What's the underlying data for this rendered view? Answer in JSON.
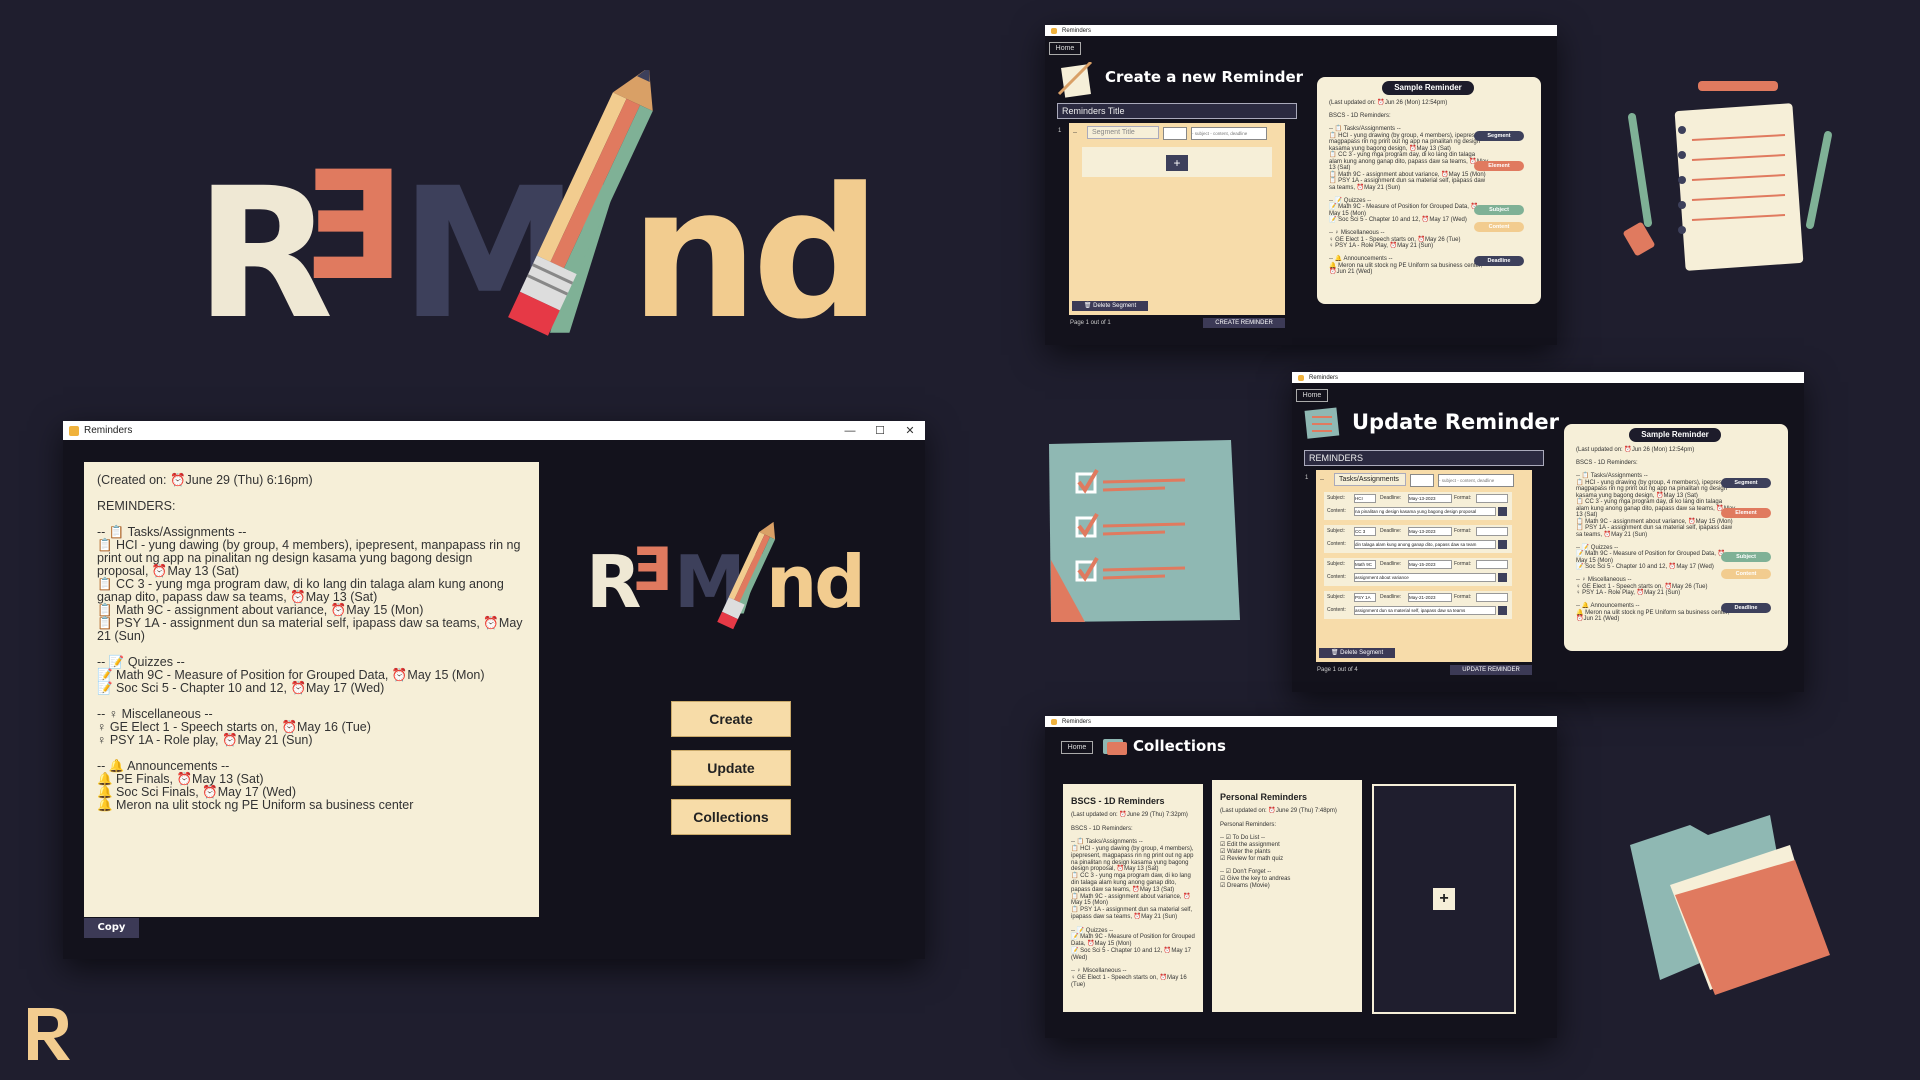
{
  "brand": {
    "logo_letters": [
      "R",
      "Ǝ",
      "M",
      "/",
      "nd"
    ],
    "colors": {
      "bg": "#1f1e2e",
      "cream": "#f6efd8",
      "orange": "#e07a5f",
      "navy": "#3d405b",
      "green": "#7fb196",
      "sand": "#f2cc8f"
    }
  },
  "main_window": {
    "title": "Reminders",
    "controls": {
      "minimize": "—",
      "maximize": "☐",
      "close": "✕"
    },
    "content": "(Created on: ⏰June 29 (Thu) 6:16pm)\n\nREMINDERS:\n\n-- 📋 Tasks/Assignments --\n📋 HCI - yung dawing (by group, 4 members), ipepresent, manpapass rin ng print out ng app na pinalitan ng design kasama yung bagong design proposal, ⏰May 13 (Sat)\n📋 CC 3 - yung mga program daw, di ko lang din talaga alam kung anong ganap dito, papass daw sa teams, ⏰May 13 (Sat)\n📋 Math 9C - assignment about variance, ⏰May 15 (Mon)\n📋 PSY 1A - assignment dun sa material self, ipapass daw sa teams, ⏰May 21 (Sun)\n\n-- 📝 Quizzes --\n📝 Math 9C - Measure of Position for Grouped Data, ⏰May 15 (Mon)\n📝 Soc Sci 5 - Chapter 10 and 12, ⏰May 17 (Wed)\n\n-- ♀ Miscellaneous --\n♀ GE Elect 1 - Speech starts on, ⏰May 16 (Tue)\n♀ PSY 1A - Role play, ⏰May 21 (Sun)\n\n-- 🔔 Announcements --\n🔔 PE Finals, ⏰May 13 (Sat)\n🔔 Soc Sci Finals, ⏰May 17 (Wed)\n🔔 Meron na ulit stock ng PE Uniform sa business center",
    "copy_label": "Copy",
    "buttons": {
      "create": "Create",
      "update": "Update",
      "collections": "Collections"
    }
  },
  "create_window": {
    "title": "Reminders",
    "home_label": "Home",
    "heading": "Create a new Reminder",
    "title_field": "Reminders Title",
    "row_number": "1",
    "dash": "--",
    "segment_placeholder": "Segment Title",
    "format_placeholder": "- subject - content, deadline",
    "plus": "+",
    "delete_label": "🗑 Delete Segment",
    "page_label": "Page 1 out of 1",
    "create_label": "CREATE REMINDER"
  },
  "update_window": {
    "title": "Reminders",
    "home_label": "Home",
    "heading": "Update Reminder",
    "title_field": "REMINDERS",
    "row_number": "1",
    "dash": "--",
    "segment_value": "Tasks/Assignments",
    "format_placeholder": "- subject - content, deadline",
    "rows": [
      {
        "subject": "HCI",
        "deadline": "May-13-2023",
        "content": "na pinalitan ng design kasama yung bagong design proposal"
      },
      {
        "subject": "CC 3",
        "deadline": "May-13-2023",
        "content": "din talaga alam kung anong ganap dito, papass daw sa team"
      },
      {
        "subject": "Math 9C",
        "deadline": "May-15-2023",
        "content": "assignment about variance"
      },
      {
        "subject": "PSY 1A",
        "deadline": "May-21-2023",
        "content": "assignment dun sa material self, ipapass daw sa teams"
      }
    ],
    "labels": {
      "subject": "Subject:",
      "deadline": "Deadline:",
      "format": "Format:",
      "content": "Content:"
    },
    "delete_label": "🗑 Delete Segment",
    "page_label": "Page 1 out of 4",
    "update_label": "UPDATE REMINDER"
  },
  "sample_panel": {
    "header": "Sample Reminder",
    "text": "(Last updated on: ⏰Jun 26 (Mon) 12:54pm)\n\nBSCS - 1D Reminders:\n\n-- 📋 Tasks/Assignments --\n📋 HCI - yung drawing (by group, 4 members), ipepresent, magpapass rin ng print out ng app na pinalitan ng design kasama yung bagong design, ⏰May 13 (Sat)\n📋 CC 3 - yung mga program day, di ko lang din talaga alam kung anong ganap dito, papass daw sa teams, ⏰May 13 (Sat)\n📋 Math 9C - assignment about variance, ⏰May 15 (Mon)\n📋 PSY 1A - assignment dun sa material self, ipapass daw sa teams, ⏰May 21 (Sun)\n\n-- 📝 Quizzes --\n📝 Math 9C - Measure of Position for Grouped Data, ⏰May 15 (Mon)\n📝 Soc Sci 5 - Chapter 10 and 12, ⏰May 17 (Wed)\n\n-- ♀ Miscellaneous --\n♀ GE Elect 1 - Speech starts on, ⏰May 26 (Tue)\n♀ PSY 1A - Role Play, ⏰May 21 (Sun)\n\n-- 🔔 Announcements --\n🔔 Meron na ulit stock ng PE Uniform sa business center, ⏰Jun 21 (Wed)",
    "pills": {
      "segment": "Segment",
      "element": "Element",
      "subject": "Subject",
      "content": "Content",
      "deadline": "Deadline"
    }
  },
  "collections_window": {
    "title": "Reminders",
    "home_label": "Home",
    "heading": "Collections",
    "cards": [
      {
        "title": "BSCS - 1D Reminders",
        "body": "(Last updated on: ⏰June 29 (Thu) 7:32pm)\n\nBSCS - 1D Reminders:\n\n-- 📋 Tasks/Assignments --\n📋 HCI - yung dawing (by group, 4 members), ipepresent, magpapass rin ng print out ng app na pinalitan ng design kasama yung bagong design proposal, ⏰May 13 (Sat)\n📋 CC 3 - yung mga program daw, di ko lang din talaga alam kung anong ganap dito, papass daw sa teams, ⏰May 13 (Sat)\n📋 Math 9C - assignment about variance, ⏰May 15 (Mon)\n📋 PSY 1A - assignment dun sa material self, ipapass daw sa teams, ⏰May 21 (Sun)\n\n-- 📝 Quizzes --\n📝 Math 9C - Measure of Position for Grouped Data, ⏰May 15 (Mon)\n📝 Soc Sci 5 - Chapter 10 and 12, ⏰May 17 (Wed)\n\n-- ♀ Miscellaneous --\n♀ GE Elect 1 - Speech starts on, ⏰May 16 (Tue)"
      },
      {
        "title": "Personal Reminders",
        "body": "(Last updated on: ⏰June 29 (Thu) 7:48pm)\n\nPersonal Reminders:\n\n-- ☑ To Do List --\n☑ Edit the assignment\n☑ Water the plants\n☑ Review for math quiz\n\n-- ☑ Don't Forget --\n☑ Give the key to andreas\n☑ Dreams (Movie)"
      }
    ],
    "add_label": "+"
  }
}
